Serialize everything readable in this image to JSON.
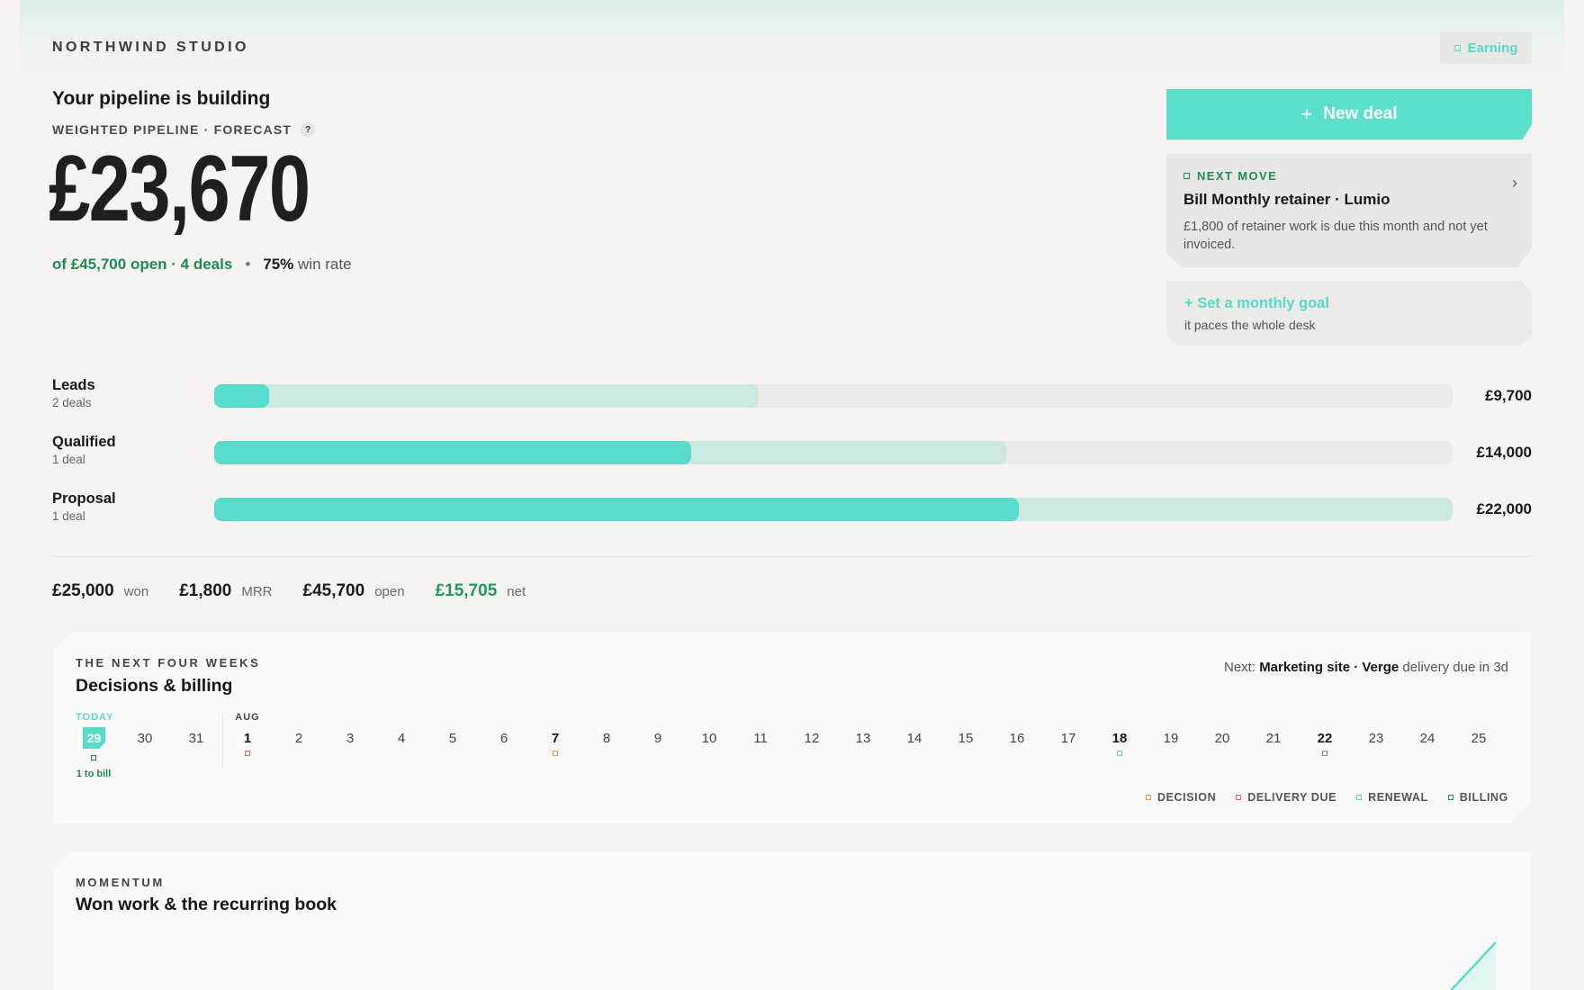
{
  "header": {
    "brand": "NORTHWIND STUDIO",
    "status": "Earning"
  },
  "hero": {
    "title": "Your pipeline is building",
    "subtitle": "WEIGHTED PIPELINE · FORECAST",
    "help": "?",
    "amount": "£23,670",
    "open_text": "of £45,700 open · 4 deals",
    "separator": "•",
    "win_rate": "75%",
    "win_rate_label": "win rate"
  },
  "actions": {
    "new_deal_icon": "+",
    "new_deal_label": "New deal"
  },
  "next_move": {
    "kicker": "NEXT MOVE",
    "title": "Bill Monthly retainer · Lumio",
    "text": "£1,800 of retainer work is due this month and not yet invoiced.",
    "chevron": "›"
  },
  "goal": {
    "title": "+ Set a monthly goal",
    "subtitle": "it paces the whole desk"
  },
  "stages": [
    {
      "name": "Leads",
      "count": "2 deals",
      "amount": "£9,700",
      "fill": 0.044,
      "ghost": 0.44
    },
    {
      "name": "Qualified",
      "count": "1 deal",
      "amount": "£14,000",
      "fill": 0.385,
      "ghost": 0.64
    },
    {
      "name": "Proposal",
      "count": "1 deal",
      "amount": "£22,000",
      "fill": 0.65,
      "ghost": 1.0
    }
  ],
  "totals": [
    {
      "value": "£25,000",
      "label": "won"
    },
    {
      "value": "£1,800",
      "label": "MRR"
    },
    {
      "value": "£45,700",
      "label": "open"
    },
    {
      "value": "£15,705",
      "label": "net"
    }
  ],
  "weeks": {
    "kicker": "THE NEXT FOUR WEEKS",
    "title": "Decisions & billing",
    "next_prefix": "Next:",
    "next_item": "Marketing site · Verge",
    "next_suffix": "delivery due in 3d",
    "today_label": "TODAY",
    "month_label": "AUG",
    "today_note": "1 to bill",
    "days": [
      "29",
      "30",
      "31",
      "1",
      "2",
      "3",
      "4",
      "5",
      "6",
      "7",
      "8",
      "9",
      "10",
      "11",
      "12",
      "13",
      "14",
      "15",
      "16",
      "17",
      "18",
      "19",
      "20",
      "21",
      "22",
      "23",
      "24",
      "25"
    ],
    "markers": {
      "0": "billing",
      "3": "delivery",
      "9": "decision",
      "20": "renewal",
      "24": "delivery"
    },
    "legend": [
      {
        "key": "decision",
        "label": "DECISION",
        "color": "#d9a441"
      },
      {
        "key": "delivery",
        "label": "DELIVERY DUE",
        "color": "#e0606e"
      },
      {
        "key": "renewal",
        "label": "RENEWAL",
        "color": "#5ad8c8"
      },
      {
        "key": "billing",
        "label": "BILLING",
        "color": "#1d8c55"
      }
    ]
  },
  "momentum": {
    "kicker": "MOMENTUM",
    "title": "Won work & the recurring book"
  },
  "colors": {
    "accent": "#5adfcb",
    "positive": "#1d8c55",
    "background": "#f5f4f1"
  }
}
